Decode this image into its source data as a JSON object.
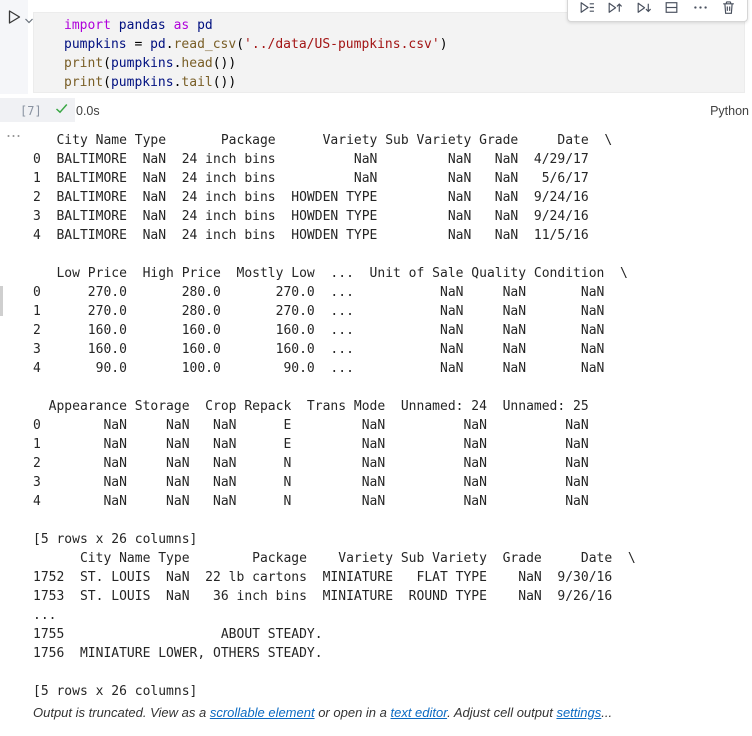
{
  "colors": {
    "keyword": "#af00db",
    "identifier": "#001080",
    "function": "#795e26",
    "string": "#a31515",
    "editor_background": "#f3f3f3",
    "link": "#0b6ac2",
    "success_check": "#3aa745",
    "icon": "#49505e"
  },
  "editor": {
    "code_lines": [
      [
        {
          "t": "import",
          "c": "keyword"
        },
        {
          "t": " ",
          "c": "plain"
        },
        {
          "t": "pandas",
          "c": "ident"
        },
        {
          "t": " ",
          "c": "plain"
        },
        {
          "t": "as",
          "c": "keyword"
        },
        {
          "t": " ",
          "c": "plain"
        },
        {
          "t": "pd",
          "c": "ident"
        }
      ],
      [
        {
          "t": "pumpkins",
          "c": "ident"
        },
        {
          "t": " = ",
          "c": "plain"
        },
        {
          "t": "pd",
          "c": "ident"
        },
        {
          "t": ".",
          "c": "plain"
        },
        {
          "t": "read_csv",
          "c": "fn"
        },
        {
          "t": "(",
          "c": "plain"
        },
        {
          "t": "'../data/US-pumpkins.csv'",
          "c": "str"
        },
        {
          "t": ")",
          "c": "plain"
        }
      ],
      [
        {
          "t": "print",
          "c": "fn"
        },
        {
          "t": "(",
          "c": "plain"
        },
        {
          "t": "pumpkins",
          "c": "ident"
        },
        {
          "t": ".",
          "c": "plain"
        },
        {
          "t": "head",
          "c": "fn"
        },
        {
          "t": "())",
          "c": "plain"
        }
      ],
      [
        {
          "t": "print",
          "c": "fn"
        },
        {
          "t": "(",
          "c": "plain"
        },
        {
          "t": "pumpkins",
          "c": "ident"
        },
        {
          "t": ".",
          "c": "plain"
        },
        {
          "t": "tail",
          "c": "fn"
        },
        {
          "t": "())",
          "c": "plain"
        }
      ]
    ]
  },
  "toolbar": {
    "icons": [
      "run-by-line",
      "execute-above-cells",
      "execute-cell-and-below",
      "split-cell",
      "more-actions",
      "delete-cell"
    ]
  },
  "execution": {
    "count": "[7]",
    "duration": "0.0s",
    "language": "Python"
  },
  "output": {
    "lines": [
      "   City Name Type       Package      Variety Sub Variety Grade     Date  \\",
      "0  BALTIMORE  NaN  24 inch bins          NaN         NaN   NaN  4/29/17",
      "1  BALTIMORE  NaN  24 inch bins          NaN         NaN   NaN   5/6/17",
      "2  BALTIMORE  NaN  24 inch bins  HOWDEN TYPE         NaN   NaN  9/24/16",
      "3  BALTIMORE  NaN  24 inch bins  HOWDEN TYPE         NaN   NaN  9/24/16",
      "4  BALTIMORE  NaN  24 inch bins  HOWDEN TYPE         NaN   NaN  11/5/16",
      "",
      "   Low Price  High Price  Mostly Low  ...  Unit of Sale Quality Condition  \\",
      "0      270.0       280.0       270.0  ...           NaN     NaN       NaN",
      "1      270.0       280.0       270.0  ...           NaN     NaN       NaN",
      "2      160.0       160.0       160.0  ...           NaN     NaN       NaN",
      "3      160.0       160.0       160.0  ...           NaN     NaN       NaN",
      "4       90.0       100.0        90.0  ...           NaN     NaN       NaN",
      "",
      "  Appearance Storage  Crop Repack  Trans Mode  Unnamed: 24  Unnamed: 25",
      "0        NaN     NaN   NaN      E         NaN          NaN          NaN",
      "1        NaN     NaN   NaN      E         NaN          NaN          NaN",
      "2        NaN     NaN   NaN      N         NaN          NaN          NaN",
      "3        NaN     NaN   NaN      N         NaN          NaN          NaN",
      "4        NaN     NaN   NaN      N         NaN          NaN          NaN",
      "",
      "[5 rows x 26 columns]",
      "      City Name Type        Package    Variety Sub Variety  Grade     Date  \\",
      "1752  ST. LOUIS  NaN  22 lb cartons  MINIATURE   FLAT TYPE    NaN  9/30/16",
      "1753  ST. LOUIS  NaN   36 inch bins  MINIATURE  ROUND TYPE    NaN  9/26/16",
      "...",
      "1755                    ABOUT STEADY.",
      "1756  MINIATURE LOWER, OTHERS STEADY.",
      "",
      "[5 rows x 26 columns]"
    ]
  },
  "truncation_notice": {
    "segments": [
      {
        "text": "Output is truncated. View as a ",
        "link": false
      },
      {
        "text": "scrollable element",
        "link": true
      },
      {
        "text": " or open in a ",
        "link": false
      },
      {
        "text": "text editor",
        "link": true
      },
      {
        "text": ". Adjust cell output ",
        "link": false
      },
      {
        "text": "settings",
        "link": true
      },
      {
        "text": "...",
        "link": false
      }
    ]
  }
}
